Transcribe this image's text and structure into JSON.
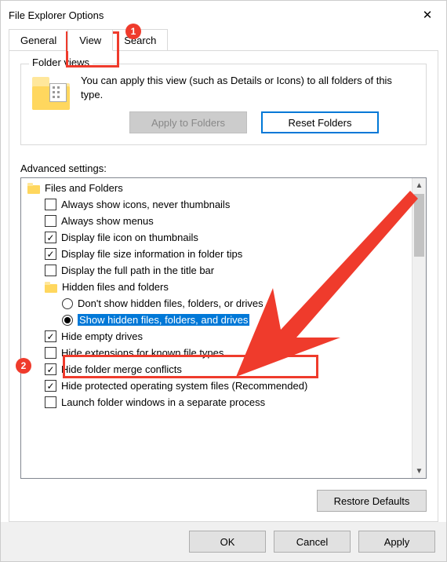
{
  "dialog": {
    "title": "File Explorer Options",
    "close_glyph": "✕"
  },
  "tabs": {
    "general": "General",
    "view": "View",
    "search": "Search"
  },
  "folder_views": {
    "group_title": "Folder views",
    "text": "You can apply this view (such as Details or Icons) to all folders of this type.",
    "apply_label": "Apply to Folders",
    "reset_label": "Reset Folders"
  },
  "advanced": {
    "label": "Advanced settings:",
    "items": [
      {
        "kind": "folder",
        "indent": 0,
        "label": "Files and Folders"
      },
      {
        "kind": "check",
        "indent": 1,
        "checked": false,
        "label": "Always show icons, never thumbnails"
      },
      {
        "kind": "check",
        "indent": 1,
        "checked": false,
        "label": "Always show menus"
      },
      {
        "kind": "check",
        "indent": 1,
        "checked": true,
        "label": "Display file icon on thumbnails"
      },
      {
        "kind": "check",
        "indent": 1,
        "checked": true,
        "label": "Display file size information in folder tips"
      },
      {
        "kind": "check",
        "indent": 1,
        "checked": false,
        "label": "Display the full path in the title bar"
      },
      {
        "kind": "folder",
        "indent": 1,
        "label": "Hidden files and folders"
      },
      {
        "kind": "radio",
        "indent": 2,
        "checked": false,
        "label": "Don't show hidden files, folders, or drives"
      },
      {
        "kind": "radio",
        "indent": 2,
        "checked": true,
        "label": "Show hidden files, folders, and drives",
        "selected": true
      },
      {
        "kind": "check",
        "indent": 1,
        "checked": true,
        "label": "Hide empty drives"
      },
      {
        "kind": "check",
        "indent": 1,
        "checked": false,
        "label": "Hide extensions for known file types"
      },
      {
        "kind": "check",
        "indent": 1,
        "checked": true,
        "label": "Hide folder merge conflicts"
      },
      {
        "kind": "check",
        "indent": 1,
        "checked": true,
        "label": "Hide protected operating system files (Recommended)"
      },
      {
        "kind": "check",
        "indent": 1,
        "checked": false,
        "label": "Launch folder windows in a separate process"
      }
    ],
    "scroll_up": "▲",
    "scroll_down": "▼",
    "restore_label": "Restore Defaults"
  },
  "buttons": {
    "ok": "OK",
    "cancel": "Cancel",
    "apply": "Apply"
  },
  "annotations": {
    "badge1": "1",
    "badge2": "2"
  }
}
